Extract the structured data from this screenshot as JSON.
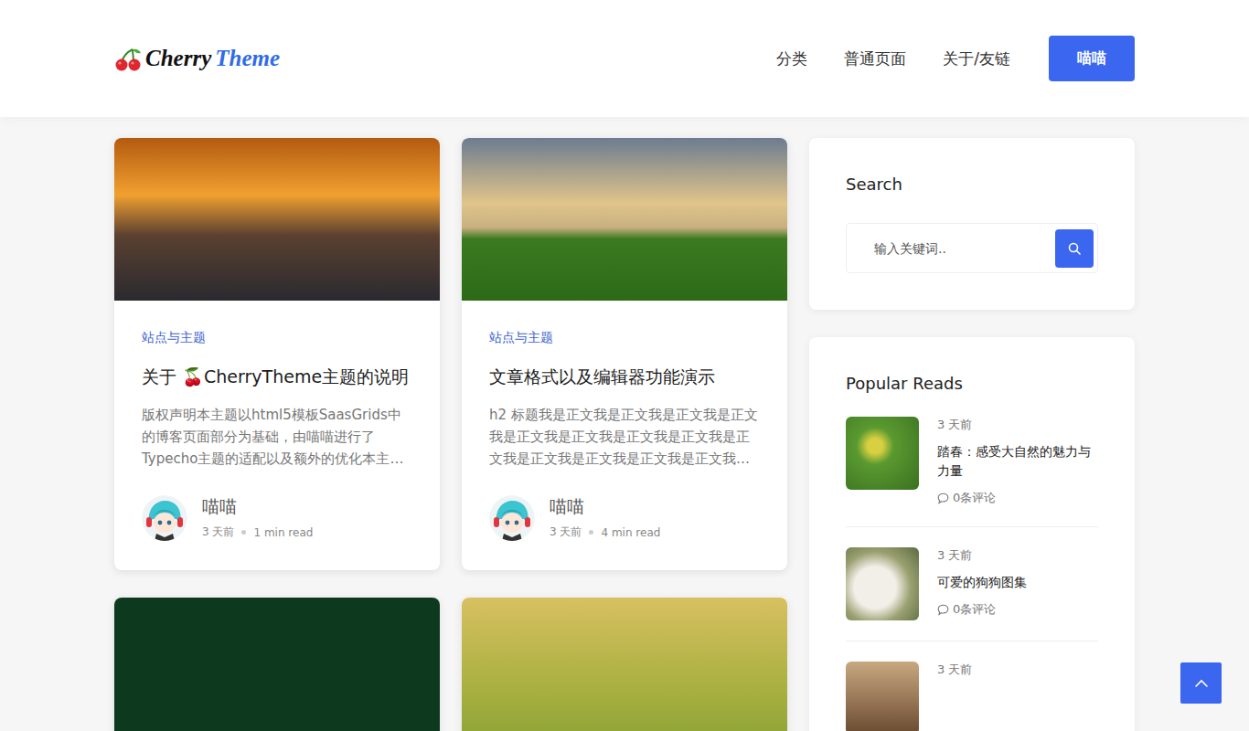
{
  "header": {
    "logo": {
      "first": "Cherry",
      "second": "Theme"
    },
    "nav": [
      {
        "label": "分类"
      },
      {
        "label": "普通页面"
      },
      {
        "label": "关于/友链"
      }
    ],
    "button": "喵喵"
  },
  "posts": [
    {
      "category": "站点与主题",
      "title": "关于 🍒CherryTheme主题的说明",
      "excerpt": "版权声明本主题以html5模板SaasGrids中的博客页面部分为基础，由喵喵进行了Typecho主题的适配以及额外的优化本主…",
      "author": "喵喵",
      "time": "3 天前",
      "read": "1 min read"
    },
    {
      "category": "站点与主题",
      "title": "文章格式以及编辑器功能演示",
      "excerpt": "h2 标题我是正文我是正文我是正文我是正文我是正文我是正文我是正文我是正文我是正文我是正文我是正文我是正文我是正文我…",
      "author": "喵喵",
      "time": "3 天前",
      "read": "4 min read"
    },
    {},
    {}
  ],
  "sidebar": {
    "search": {
      "title": "Search",
      "placeholder": "输入关键词.."
    },
    "popular": {
      "title": "Popular Reads",
      "items": [
        {
          "time": "3 天前",
          "title": "踏春：感受大自然的魅力与力量",
          "comments": "0条评论"
        },
        {
          "time": "3 天前",
          "title": "可爱的狗狗图集",
          "comments": "0条评论"
        },
        {
          "time": "3 天前"
        }
      ]
    }
  }
}
